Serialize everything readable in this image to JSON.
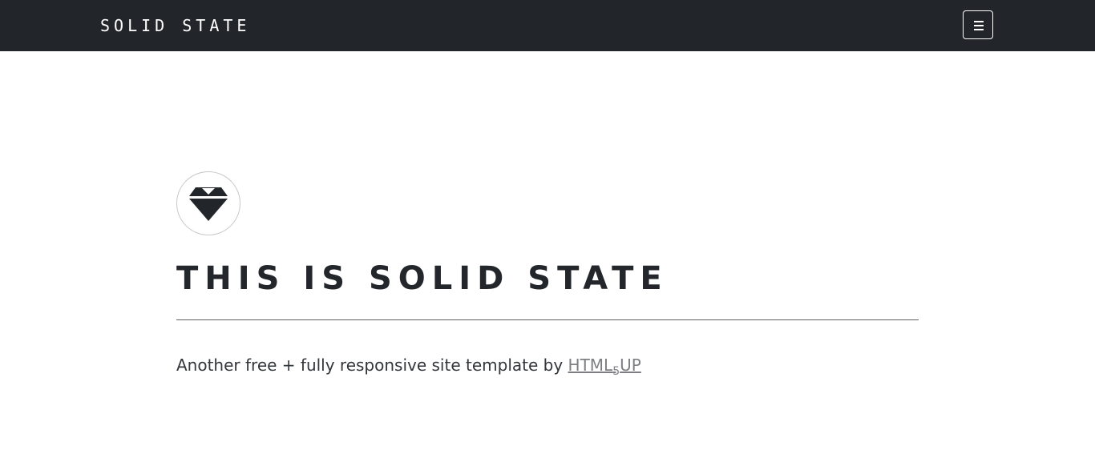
{
  "header": {
    "brand": "SOLID STATE",
    "menu_icon": "hamburger-menu-icon"
  },
  "hero": {
    "logo_icon": "diamond-icon",
    "title": "THIS IS SOLID STATE",
    "tagline_text": "Another free + fully responsive site template by",
    "link_prefix": "HTML",
    "link_sub": "5",
    "link_suffix": "UP"
  },
  "colors": {
    "header_bg": "#22252a",
    "header_text": "#ffffff",
    "title": "#23262b",
    "body_text": "#33363b",
    "link": "#7d7f83",
    "rule": "#5d5f63"
  }
}
